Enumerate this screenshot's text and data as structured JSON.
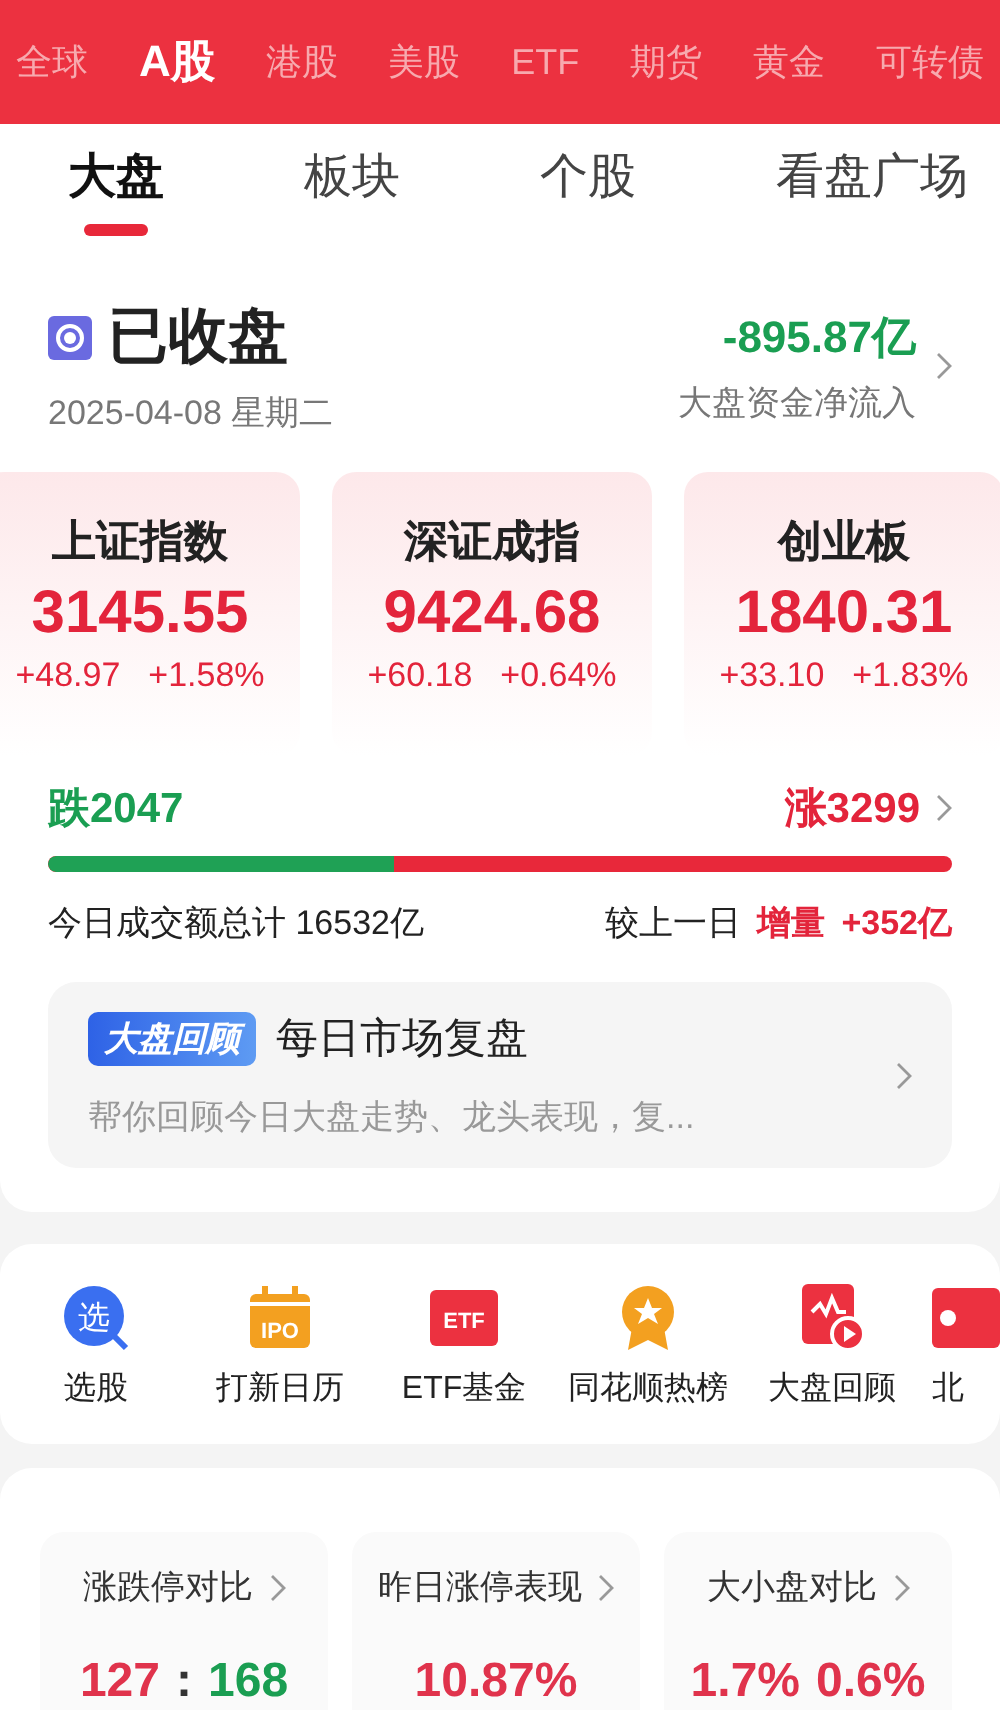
{
  "market_tabs": [
    {
      "label": "全球",
      "selected": false
    },
    {
      "label": "A股",
      "selected": true
    },
    {
      "label": "港股",
      "selected": false
    },
    {
      "label": "美股",
      "selected": false
    },
    {
      "label": "ETF",
      "selected": false
    },
    {
      "label": "期货",
      "selected": false
    },
    {
      "label": "黄金",
      "selected": false
    },
    {
      "label": "可转债",
      "selected": false
    }
  ],
  "sub_tabs": [
    {
      "label": "大盘",
      "selected": true
    },
    {
      "label": "板块",
      "selected": false
    },
    {
      "label": "个股",
      "selected": false
    },
    {
      "label": "看盘广场",
      "selected": false
    }
  ],
  "status": {
    "title": "已收盘",
    "date": "2025-04-08 星期二",
    "net_flow": "-895.87亿",
    "net_flow_label": "大盘资金净流入"
  },
  "indices": [
    {
      "name": "上证指数",
      "value": "3145.55",
      "change": "+48.97",
      "percent": "+1.58%"
    },
    {
      "name": "深证成指",
      "value": "9424.68",
      "change": "+60.18",
      "percent": "+0.64%"
    },
    {
      "name": "创业板",
      "value": "1840.31",
      "change": "+33.10",
      "percent": "+1.83%"
    }
  ],
  "breadth": {
    "down": "跌2047",
    "up": "涨3299",
    "level": 0.383
  },
  "turnover": {
    "label": "今日成交额总计 16532亿",
    "compare_label": "较上一日",
    "change_label": "增量",
    "change_value": "+352亿"
  },
  "review": {
    "badge": "大盘回顾",
    "title": "每日市场复盘",
    "summary": "帮你回顾今日大盘走势、龙头表现，复..."
  },
  "shortcuts": [
    {
      "kind": "pick",
      "glyph": "选",
      "label": "选股"
    },
    {
      "kind": "calendar",
      "glyph": "IPO",
      "label": "打新日历"
    },
    {
      "kind": "tile",
      "glyph": "ETF",
      "label": "ETF基金"
    },
    {
      "kind": "medal",
      "label": "同花顺热榜"
    },
    {
      "kind": "replay",
      "label": "大盘回顾"
    },
    {
      "kind": "partial",
      "label": "北"
    }
  ],
  "stats": [
    {
      "title": "涨跌停对比",
      "values": [
        {
          "text": "127",
          "color": "#e0334c"
        },
        {
          "text": ":",
          "color": "#333333"
        },
        {
          "text": "168",
          "color": "#1a9e52"
        }
      ]
    },
    {
      "title": "昨日涨停表现",
      "values": [
        {
          "text": "10.87%",
          "color": "#e0334c"
        }
      ]
    },
    {
      "title": "大小盘对比",
      "values": [
        {
          "text": "1.7%",
          "color": "#e0334c"
        },
        {
          "text": "0.6%",
          "color": "#e0334c"
        }
      ]
    }
  ]
}
